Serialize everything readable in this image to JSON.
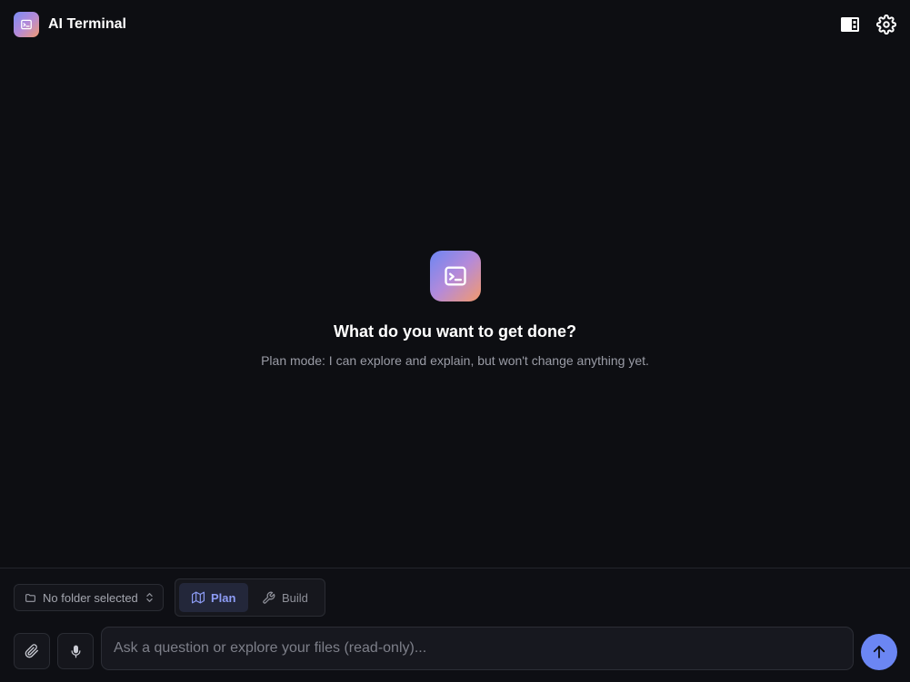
{
  "header": {
    "title": "AI Terminal",
    "logo_icon": "terminal-icon",
    "layout_icon": "panel-layout-icon",
    "settings_icon": "gear-icon"
  },
  "empty_state": {
    "icon": "terminal-icon",
    "title": "What do you want to get done?",
    "subtitle": "Plan mode: I can explore and explain, but won't change anything yet."
  },
  "toolbar": {
    "folder_label": "No folder selected",
    "folder_icon": "folder-icon",
    "modes": [
      {
        "label": "Plan",
        "icon": "map-icon",
        "active": true
      },
      {
        "label": "Build",
        "icon": "wrench-icon",
        "active": false
      }
    ]
  },
  "composer": {
    "placeholder": "Ask a question or explore your files (read-only)...",
    "value": "",
    "attach_icon": "paperclip-icon",
    "mic_icon": "microphone-icon",
    "send_icon": "arrow-up-icon"
  },
  "colors": {
    "background": "#0d0e12",
    "accent": "#6b86f3",
    "active_mode_text": "#8d9cf5"
  }
}
